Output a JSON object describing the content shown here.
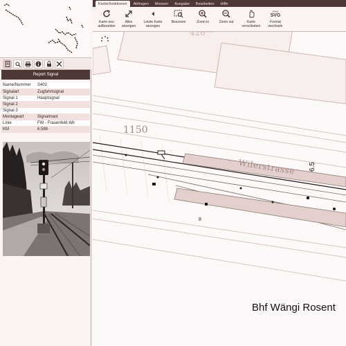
{
  "menu": {
    "tabs": [
      {
        "label": "Kartenfunktionen",
        "active": true
      },
      {
        "label": "Abfragen"
      },
      {
        "label": "Messen"
      },
      {
        "label": "Ausgabe"
      },
      {
        "label": "Bearbeiten"
      },
      {
        "label": "Hilfe"
      }
    ]
  },
  "toolbar": {
    "buttons": [
      {
        "line1": "Karte neu",
        "line2": "aufbereiten",
        "icon": "refresh-icon"
      },
      {
        "line1": "Alles",
        "line2": "anzeigen",
        "icon": "expand-icon"
      },
      {
        "line1": "Letzte Karte",
        "line2": "anzeigen",
        "icon": "back-icon"
      },
      {
        "line1": "Boxzoom",
        "line2": "",
        "icon": "boxzoom-icon"
      },
      {
        "line1": "Zoom in",
        "line2": "",
        "icon": "zoom-in-icon"
      },
      {
        "line1": "Zoom out",
        "line2": "",
        "icon": "zoom-out-icon"
      },
      {
        "line1": "Karte",
        "line2": "verschieben",
        "icon": "pan-icon"
      },
      {
        "line1": "Format",
        "line2": "wechseln",
        "icon": "format-icon"
      }
    ],
    "format_icon_top": "PNG",
    "format_icon_bottom": "SVG"
  },
  "left_tools": [
    "document-icon",
    "search-icon",
    "print-icon",
    "info-icon",
    "lock-icon",
    "tools-icon"
  ],
  "report": {
    "title": "Report Signal",
    "rows": [
      {
        "key": "Name/Nummer",
        "value": "S402"
      },
      {
        "key": "Signalart",
        "value": "Zugfahrtsignal"
      },
      {
        "key": "Signal 1",
        "value": "Hauptsignal"
      },
      {
        "key": "Signal 2",
        "value": ""
      },
      {
        "key": "Signal 3",
        "value": ""
      },
      {
        "key": "Montageart",
        "value": "Signalmast"
      },
      {
        "key": "Linie",
        "value": "FW - Frauenfeld-Wil"
      },
      {
        "key": "KM",
        "value": "6.588"
      }
    ]
  },
  "map": {
    "parcel_1150": "1150",
    "parcel_428": "428",
    "street": "Wilerstrasse",
    "km_marker": "6.5",
    "number_8": "8",
    "station_label": "Bhf Wängi Rosent"
  },
  "colors": {
    "menubar": "#4d3836",
    "building_fill": "#e3cfcb",
    "background": "#fbf4f2"
  }
}
